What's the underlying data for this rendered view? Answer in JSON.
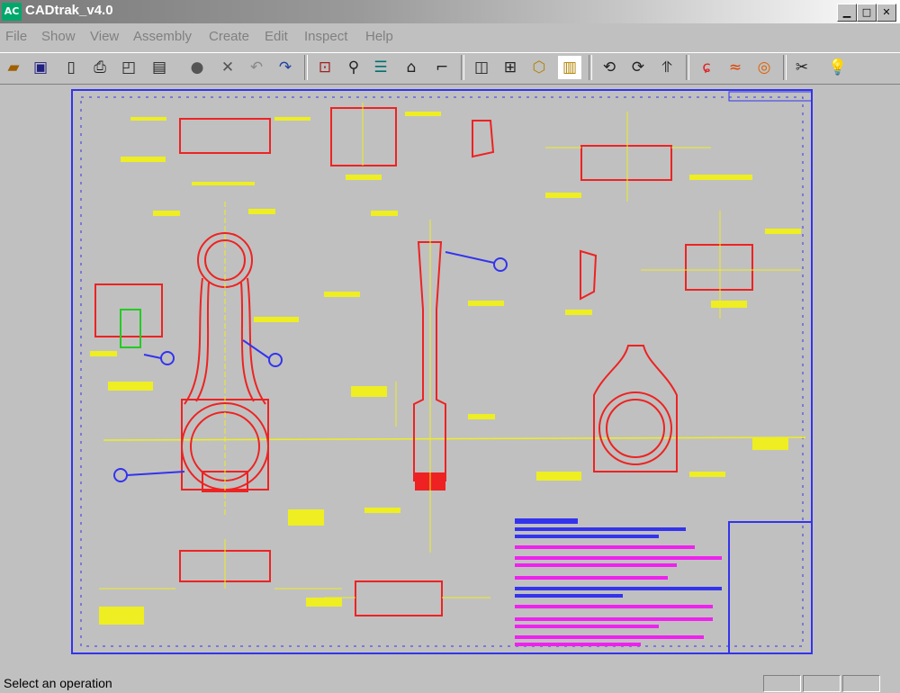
{
  "window": {
    "title": "CADtrak_v4.0",
    "app_icon": "AC"
  },
  "menu": [
    "File",
    "Show",
    "View",
    "Assembly",
    "Create",
    "Edit",
    "Inspect",
    "Help"
  ],
  "toolbar": [
    "open-icon",
    "save-icon",
    "new-icon",
    "print-icon",
    "preview-icon",
    "clipboard-icon",
    "circle-icon",
    "cross-icon",
    "undo-icon",
    "redo-icon",
    "fit-icon",
    "zoom-icon",
    "align-icon",
    "house-icon",
    "measure-icon",
    "view-front-icon",
    "view-top-icon",
    "view-iso-icon",
    "view-side-icon",
    "rotate-left-icon",
    "rotate-right-icon",
    "rotate-up-icon",
    "flame-a-icon",
    "flame-b-icon",
    "flame-c-icon",
    "scissors-icon",
    "bulb-icon"
  ],
  "drawing": {
    "annotation_colors": {
      "border": "#3333ee",
      "geometry": "#ee2222",
      "dimensions": "#eeee22",
      "notes_magenta": "#ee22ee",
      "callouts": "#3333ee"
    }
  },
  "status": {
    "text": "Select an operation"
  }
}
